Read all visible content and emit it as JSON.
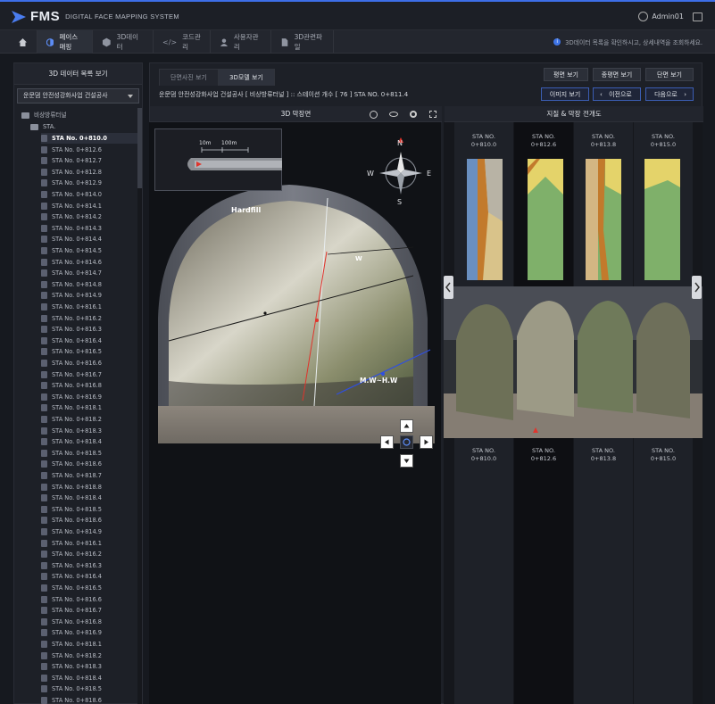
{
  "app": {
    "brand": "FMS",
    "system_name": "DIGITAL FACE MAPPING SYSTEM",
    "user": "Admin01"
  },
  "nav": {
    "items": [
      {
        "label": ""
      },
      {
        "label": "페이스매핑"
      },
      {
        "label": "3D데이터"
      },
      {
        "label": "코드관리"
      },
      {
        "label": "사용자관리"
      },
      {
        "label": "3D관련파일"
      }
    ],
    "notice": "3D데이터 목록을 확인하시고, 상세내역을 조회하세요."
  },
  "left_panel": {
    "title": "3D 데이터 목록 보기",
    "project_select": "운문댐 안전성강화사업 건설공사",
    "root_folder": "비상방류터널",
    "sub_folder": "STA.",
    "selected_index": 0,
    "items": [
      "STA No. 0+810.0",
      "STA No. 0+812.6",
      "STA No. 0+812.7",
      "STA No. 0+812.8",
      "STA No. 0+812.9",
      "STA No. 0+814.0",
      "STA No. 0+814.1",
      "STA No. 0+814.2",
      "STA No. 0+814.3",
      "STA No. 0+814.4",
      "STA No. 0+814.5",
      "STA No. 0+814.6",
      "STA No. 0+814.7",
      "STA No. 0+814.8",
      "STA No. 0+814.9",
      "STA No. 0+816.1",
      "STA No. 0+816.2",
      "STA No. 0+816.3",
      "STA No. 0+816.4",
      "STA No. 0+816.5",
      "STA No. 0+816.6",
      "STA No. 0+816.7",
      "STA No. 0+816.8",
      "STA No. 0+816.9",
      "STA No. 0+818.1",
      "STA No. 0+818.2",
      "STA No. 0+818.3",
      "STA No. 0+818.4",
      "STA No. 0+818.5",
      "STA No. 0+818.6",
      "STA No. 0+818.7",
      "STA No. 0+818.8",
      "STA No. 0+818.4",
      "STA No. 0+818.5",
      "STA No. 0+818.6",
      "STA No. 0+814.9",
      "STA No. 0+816.1",
      "STA No. 0+816.2",
      "STA No. 0+816.3",
      "STA No. 0+816.4",
      "STA No. 0+816.5",
      "STA No. 0+816.6",
      "STA No. 0+816.7",
      "STA No. 0+816.8",
      "STA No. 0+816.9",
      "STA No. 0+818.1",
      "STA No. 0+818.2",
      "STA No. 0+818.3",
      "STA No. 0+818.4",
      "STA No. 0+818.5",
      "STA No. 0+818.6"
    ]
  },
  "main": {
    "tabs": [
      "단면사진 보기",
      "3D모델 보기"
    ],
    "active_tab": 1,
    "view_buttons": [
      "평면 보기",
      "종평면 보기",
      "단면 보기"
    ],
    "subtitle": "운문댐 안전성강화사업 건설공사 [ 비상방류터널 ] :: 스테이션 개수 [ 76 ]   STA NO. 0+811.4",
    "nav_buttons": {
      "image": "이미지 보기",
      "prev": "이전으로",
      "next": "다음으로"
    },
    "section_3d_title": "3D 막장면",
    "section_geo_title": "지질 & 막장 전개도",
    "minimap": {
      "scale_10": "10m",
      "scale_100": "100m"
    },
    "compass": {
      "n": "N",
      "s": "S",
      "e": "E",
      "w": "W"
    },
    "labels": {
      "hardfill": "Hardfill",
      "w": "W",
      "mwhw": "M.W~H.W"
    },
    "stations_top": [
      {
        "l1": "STA NO.",
        "l2": "0+810.0"
      },
      {
        "l1": "STA NO.",
        "l2": "0+812.6"
      },
      {
        "l1": "STA NO.",
        "l2": "0+813.8"
      },
      {
        "l1": "STA NO.",
        "l2": "0+815.0"
      }
    ],
    "stations_bottom": [
      {
        "l1": "STA NO.",
        "l2": "0+810.0"
      },
      {
        "l1": "STA NO.",
        "l2": "0+812.6"
      },
      {
        "l1": "STA NO.",
        "l2": "0+813.8"
      },
      {
        "l1": "STA NO.",
        "l2": "0+815.0"
      }
    ]
  },
  "colors": {
    "accent": "#3d6ee8",
    "bg": "#16191f",
    "panel": "#1d2027"
  }
}
